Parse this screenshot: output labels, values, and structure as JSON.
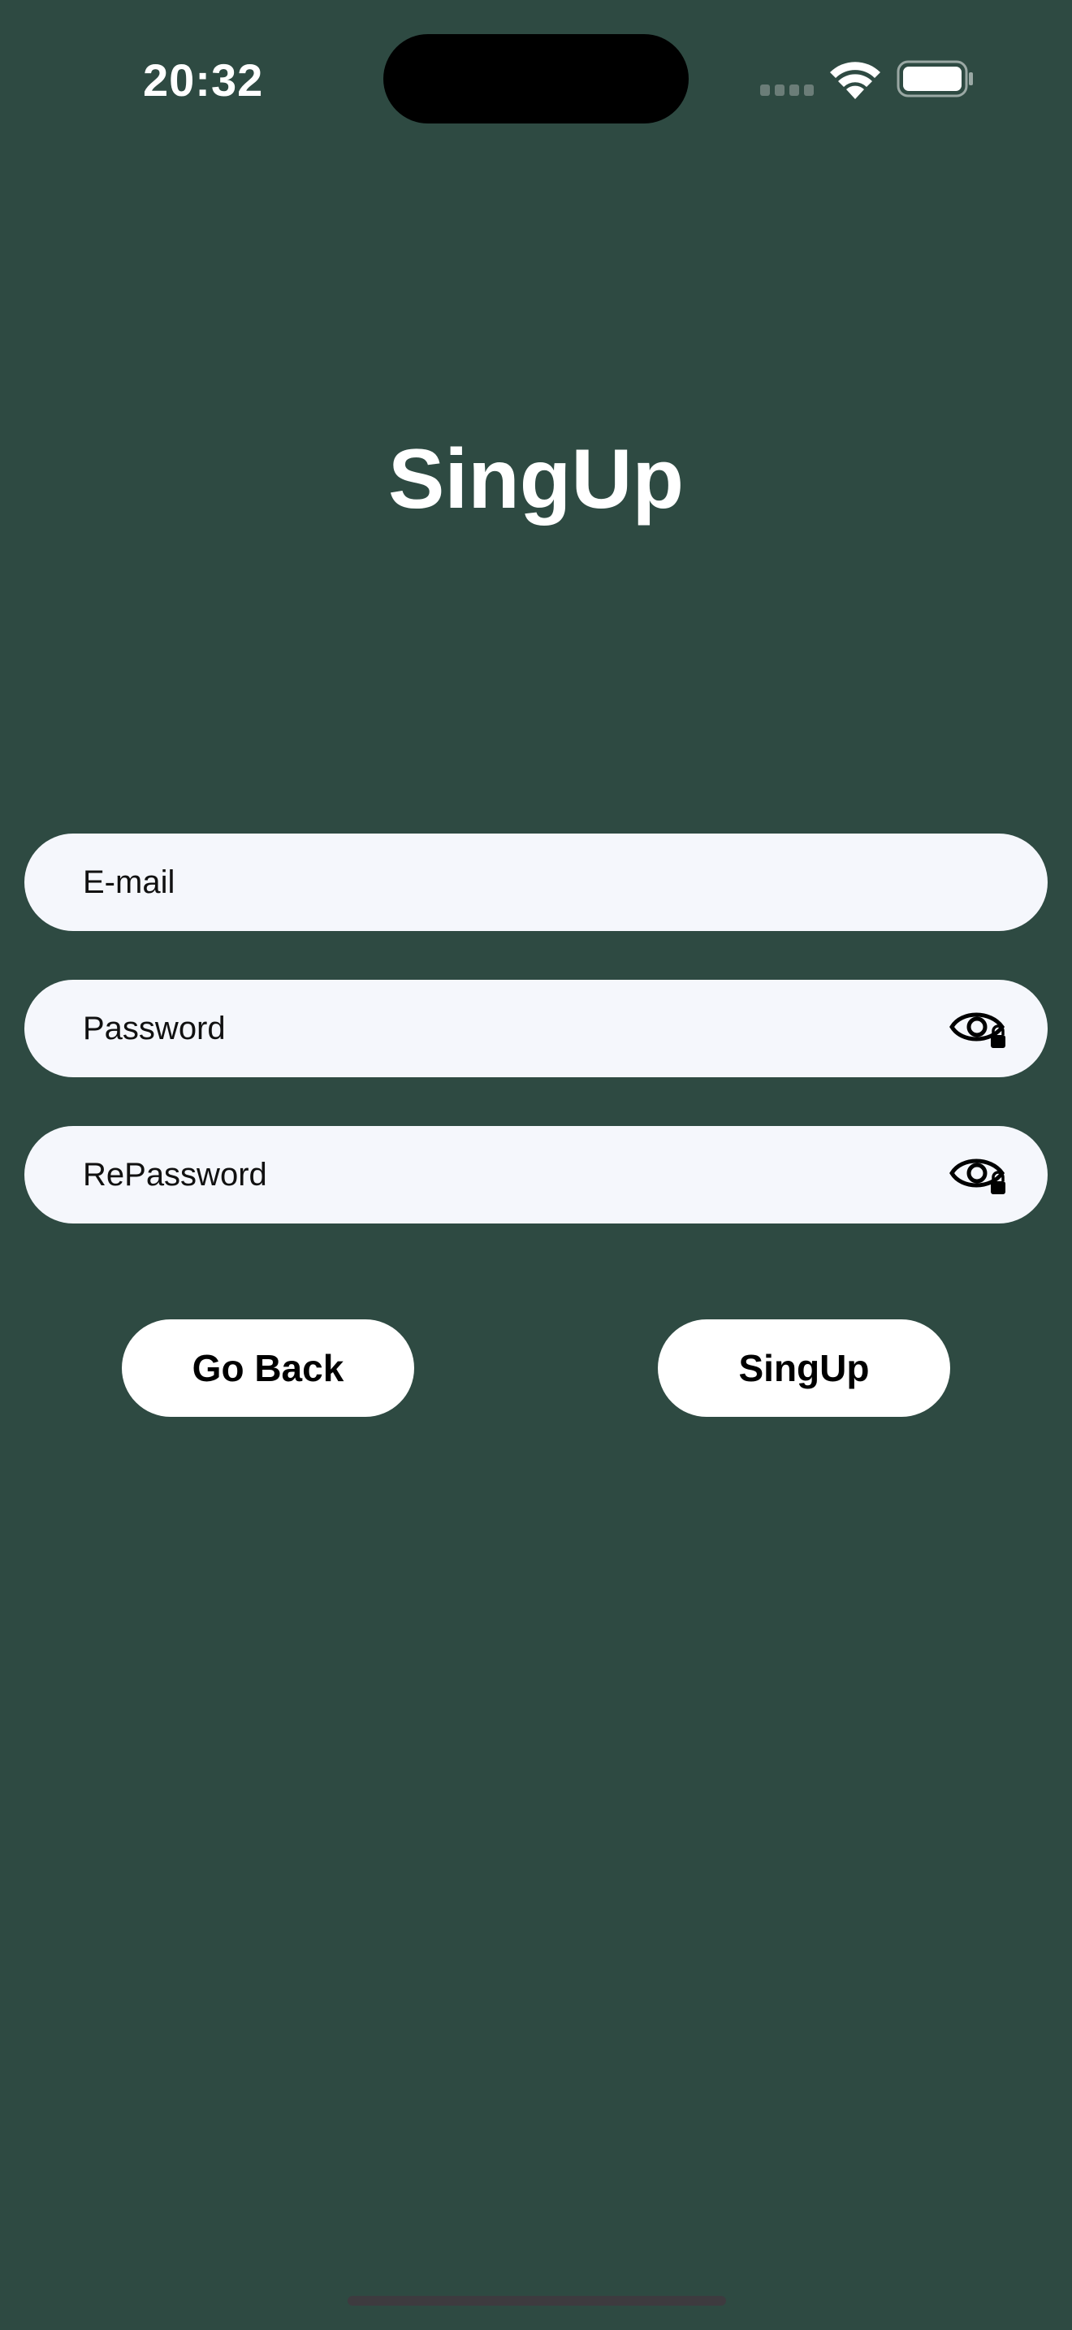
{
  "status_bar": {
    "time": "20:32",
    "signal_icon": "signal-dots-icon",
    "wifi_icon": "wifi-icon",
    "battery_icon": "battery-icon"
  },
  "page": {
    "title": "SingUp"
  },
  "form": {
    "email": {
      "placeholder": "E-mail",
      "value": ""
    },
    "password": {
      "placeholder": "Password",
      "value": "",
      "toggle_icon": "eye-lock-icon"
    },
    "repassword": {
      "placeholder": "RePassword",
      "value": "",
      "toggle_icon": "eye-lock-icon"
    }
  },
  "actions": {
    "go_back_label": "Go Back",
    "signup_label": "SingUp"
  },
  "colors": {
    "background": "#2e4a42",
    "field_background": "#f5f7fc",
    "button_background": "#ffffff",
    "text_primary": "#ffffff"
  }
}
